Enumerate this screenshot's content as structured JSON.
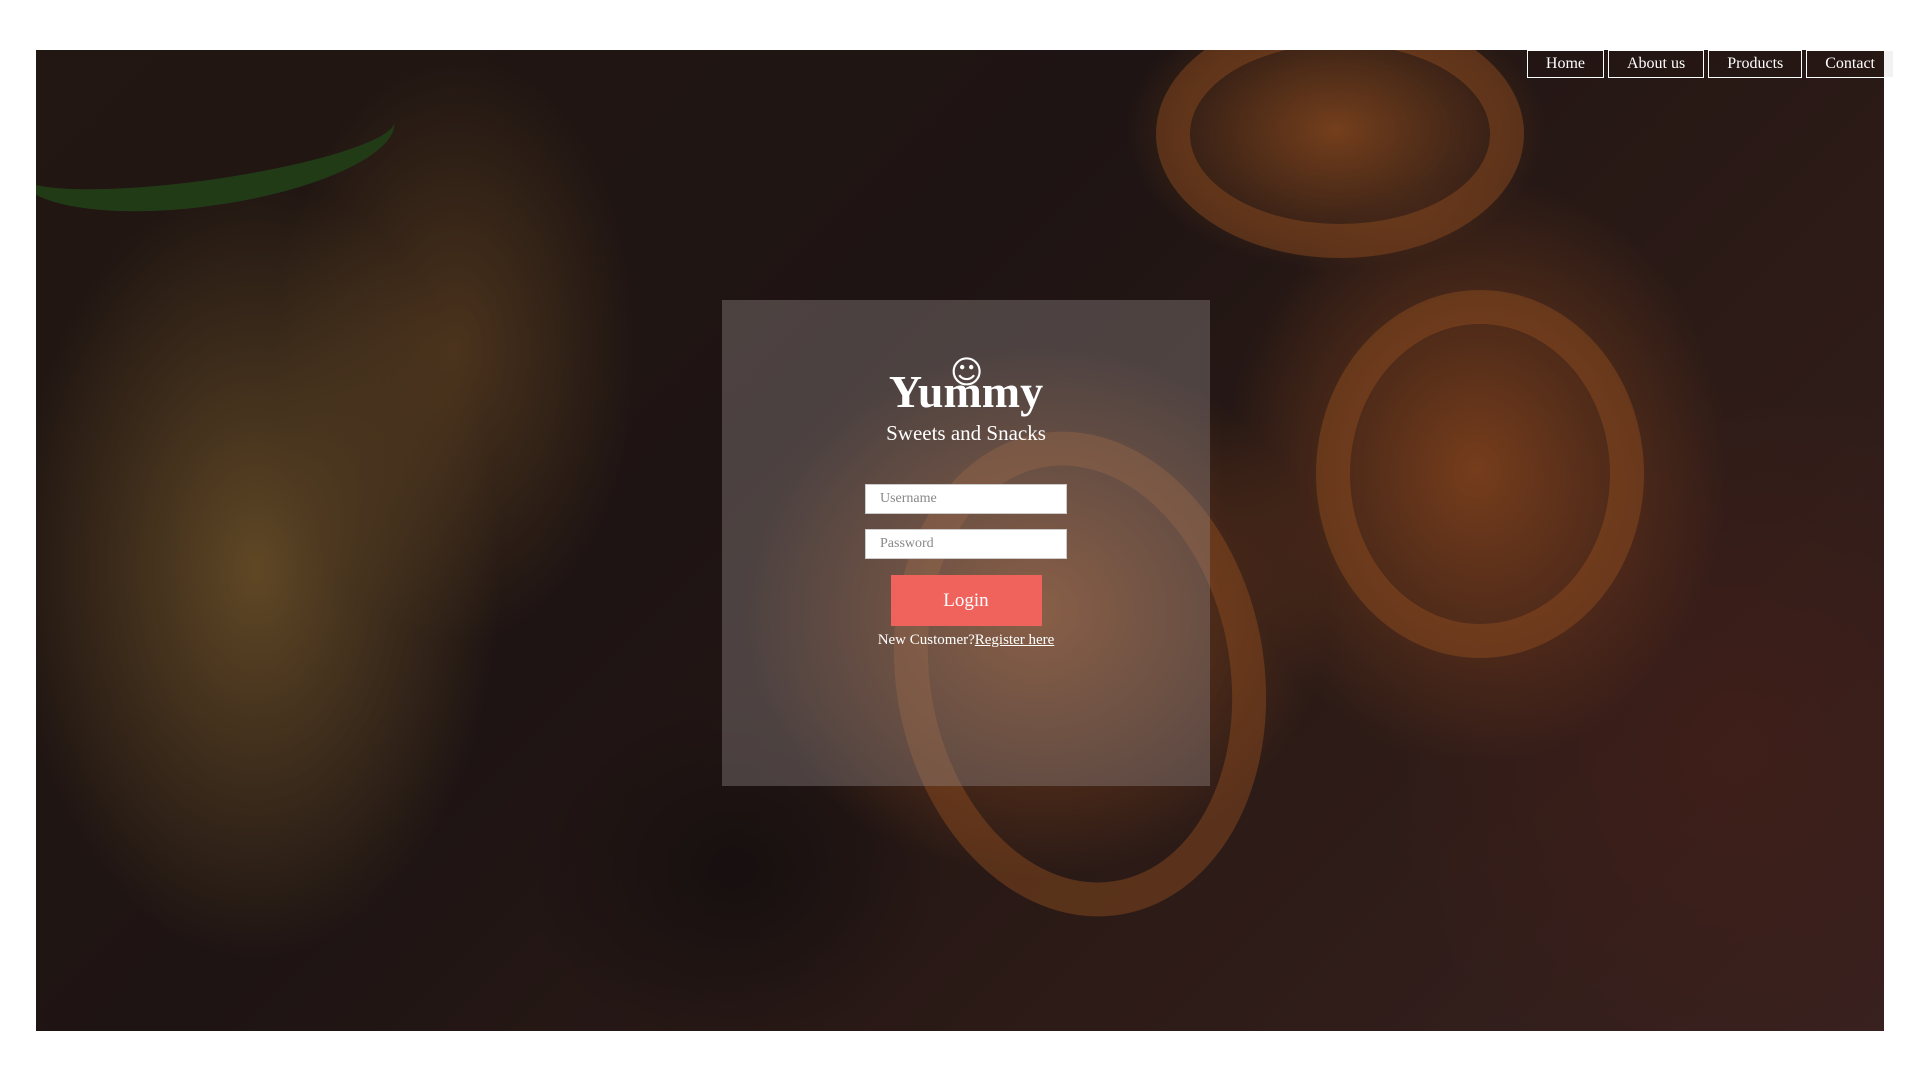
{
  "nav": {
    "items": [
      {
        "label": "Home"
      },
      {
        "label": "About us"
      },
      {
        "label": "Products"
      },
      {
        "label": "Contact"
      }
    ]
  },
  "login": {
    "brand_icon": "smile-icon",
    "title": "Yummy",
    "tagline": "Sweets and Snacks",
    "username_placeholder": "Username",
    "password_placeholder": "Password",
    "submit_label": "Login",
    "register_prompt": "New Customer?",
    "register_link": "Register here"
  },
  "colors": {
    "accent": "#f0625c",
    "text": "#ffffff"
  }
}
